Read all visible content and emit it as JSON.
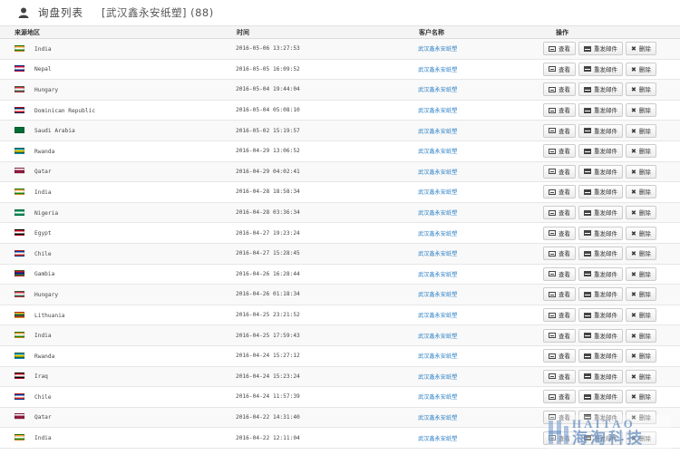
{
  "header": {
    "title": "询盘列表",
    "subtitle": "[武汉鑫永安纸塑] (88)"
  },
  "table": {
    "columns": [
      "来源地区",
      "时间",
      "客户名称",
      "操作"
    ],
    "actions": {
      "view": "查看",
      "resend": "重发邮件",
      "delete": "删除"
    },
    "rows": [
      {
        "country": "India",
        "time": "2016-05-06 13:27:53",
        "customer": "武汉鑫永安纸塑",
        "flag": [
          "#FF9933",
          "#ffffff",
          "#138808"
        ]
      },
      {
        "country": "Nepal",
        "time": "2016-05-05 16:09:52",
        "customer": "武汉鑫永安纸塑",
        "flag": [
          "#DC143C",
          "#ffffff",
          "#003893"
        ]
      },
      {
        "country": "Hungary",
        "time": "2016-05-04 19:44:04",
        "customer": "武汉鑫永安纸塑",
        "flag": [
          "#CD2A3E",
          "#ffffff",
          "#436F4D"
        ]
      },
      {
        "country": "Dominican Republic",
        "time": "2016-05-04 05:08:10",
        "customer": "武汉鑫永安纸塑",
        "flag": [
          "#002D62",
          "#ffffff",
          "#CE1126"
        ]
      },
      {
        "country": "Saudi Arabia",
        "time": "2016-05-02 15:19:57",
        "customer": "武汉鑫永安纸塑",
        "flag": [
          "#006C35",
          "#006C35",
          "#006C35"
        ]
      },
      {
        "country": "Rwanda",
        "time": "2016-04-29 13:06:52",
        "customer": "武汉鑫永安纸塑",
        "flag": [
          "#00A1DE",
          "#FAD201",
          "#20603D"
        ]
      },
      {
        "country": "Qatar",
        "time": "2016-04-29 04:02:41",
        "customer": "武汉鑫永安纸塑",
        "flag": [
          "#ffffff",
          "#8D1B3D",
          "#8D1B3D"
        ]
      },
      {
        "country": "India",
        "time": "2016-04-28 18:58:34",
        "customer": "武汉鑫永安纸塑",
        "flag": [
          "#FF9933",
          "#ffffff",
          "#138808"
        ]
      },
      {
        "country": "Nigeria",
        "time": "2016-04-28 03:36:34",
        "customer": "武汉鑫永安纸塑",
        "flag": [
          "#008751",
          "#ffffff",
          "#008751"
        ]
      },
      {
        "country": "Egypt",
        "time": "2016-04-27 19:23:24",
        "customer": "武汉鑫永安纸塑",
        "flag": [
          "#CE1126",
          "#ffffff",
          "#000000"
        ]
      },
      {
        "country": "Chile",
        "time": "2016-04-27 15:28:45",
        "customer": "武汉鑫永安纸塑",
        "flag": [
          "#0039A6",
          "#ffffff",
          "#D52B1E"
        ]
      },
      {
        "country": "Gambia",
        "time": "2016-04-26 16:28:44",
        "customer": "武汉鑫永安纸塑",
        "flag": [
          "#CE1126",
          "#0C1C8C",
          "#3A7728"
        ]
      },
      {
        "country": "Hungary",
        "time": "2016-04-26 01:18:34",
        "customer": "武汉鑫永安纸塑",
        "flag": [
          "#CD2A3E",
          "#ffffff",
          "#436F4D"
        ]
      },
      {
        "country": "Lithuania",
        "time": "2016-04-25 23:21:52",
        "customer": "武汉鑫永安纸塑",
        "flag": [
          "#FDB913",
          "#006A44",
          "#C1272D"
        ]
      },
      {
        "country": "India",
        "time": "2016-04-25 17:59:43",
        "customer": "武汉鑫永安纸塑",
        "flag": [
          "#FF9933",
          "#ffffff",
          "#138808"
        ]
      },
      {
        "country": "Rwanda",
        "time": "2016-04-24 15:27:12",
        "customer": "武汉鑫永安纸塑",
        "flag": [
          "#00A1DE",
          "#FAD201",
          "#20603D"
        ]
      },
      {
        "country": "Iraq",
        "time": "2016-04-24 15:23:24",
        "customer": "武汉鑫永安纸塑",
        "flag": [
          "#CE1126",
          "#ffffff",
          "#000000"
        ]
      },
      {
        "country": "Chile",
        "time": "2016-04-24 11:57:39",
        "customer": "武汉鑫永安纸塑",
        "flag": [
          "#0039A6",
          "#ffffff",
          "#D52B1E"
        ]
      },
      {
        "country": "Qatar",
        "time": "2016-04-22 14:31:40",
        "customer": "武汉鑫永安纸塑",
        "flag": [
          "#ffffff",
          "#8D1B3D",
          "#8D1B3D"
        ]
      },
      {
        "country": "India",
        "time": "2016-04-22 12:11:04",
        "customer": "武汉鑫永安纸塑",
        "flag": [
          "#FF9933",
          "#ffffff",
          "#138808"
        ]
      }
    ]
  },
  "watermark": {
    "en": "HAITAO",
    "cn": "海淘科技"
  },
  "icons": {
    "header": "user-icon",
    "view": "list-icon",
    "resend": "envelope-icon",
    "delete": "close-icon"
  }
}
